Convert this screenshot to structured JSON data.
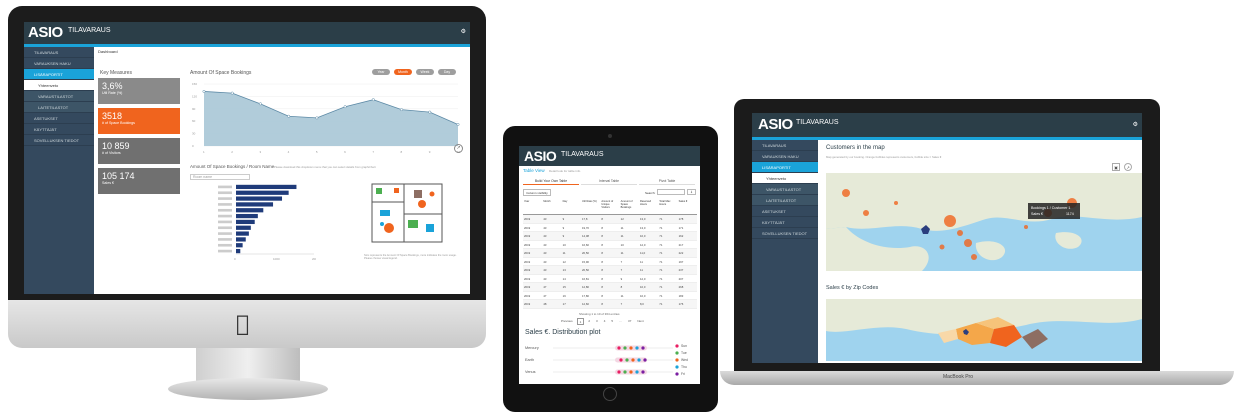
{
  "brand": {
    "name": "ASIO",
    "product": "TILAVARAUS"
  },
  "imac": {
    "breadcrumb": "Dashboard",
    "sidebar": [
      "TILAVARAUS",
      "VARAUKSEN HAKU",
      "LISÄRAPORTIT",
      "Yhteenveto",
      "VARAUSTILASTOT",
      "LAITETILASTOT",
      "ASETUKSET",
      "KÄYTTÄJÄT",
      "SOVELLUKSEN TIEDOT"
    ],
    "key_measures_title": "Key Measures",
    "kpis": [
      {
        "value": "3,6%",
        "label": "Util Rate (%)"
      },
      {
        "value": "3518",
        "label": "# of Space Bookings"
      },
      {
        "value": "10 859",
        "label": "# of Visitors"
      },
      {
        "value": "105 174",
        "label": "Sales €"
      }
    ],
    "line_chart_title": "Amount Of Space Bookings",
    "range_pills": [
      "Year",
      "Month",
      "Week",
      "Day"
    ],
    "bar_chart_title": "Amount Of Space Bookings / Room Name",
    "bar_chart_note": "Please download this dropdown menu that you can select details from graph/chart",
    "filter_placeholder": "Room name",
    "floorplan_note": "Size represents the Amount Of Space Bookings, more indicates the room usage. Please choose visual legend."
  },
  "ipad": {
    "tab_title": "Table View",
    "tab_subtitle": "Detail look for table info",
    "subtabs": [
      "Build Your Own Table",
      "Interval Table",
      "Pivot Table"
    ],
    "column_button": "Column visibility",
    "search_label": "Search:",
    "columns": [
      "Year",
      "Month",
      "Day",
      "Util Rate (%)",
      "Amount of Unique Visitors",
      "Amount of Space Bookings",
      "Reserved Hours",
      "Total Max Hours",
      "Sales €"
    ],
    "rows": [
      [
        "2019",
        "43",
        "9",
        "17,8",
        "8",
        "12",
        "13,0",
        "71",
        "178"
      ],
      [
        "2019",
        "43",
        "9",
        "19,70",
        "8",
        "11",
        "13,0",
        "71",
        "171"
      ],
      [
        "2019",
        "43",
        "9",
        "14,08",
        "8",
        "11",
        "10,0",
        "71",
        "162"
      ],
      [
        "2019",
        "43",
        "10",
        "16,60",
        "8",
        "10",
        "12,0",
        "71",
        "217"
      ],
      [
        "2019",
        "43",
        "11",
        "20,50",
        "8",
        "11",
        "11,0",
        "71",
        "222"
      ],
      [
        "2019",
        "43",
        "12",
        "15,90",
        "8",
        "7",
        "11",
        "71",
        "197"
      ],
      [
        "2019",
        "43",
        "13",
        "20,50",
        "8",
        "7",
        "11",
        "71",
        "237"
      ],
      [
        "2019",
        "43",
        "14",
        "16,81",
        "8",
        "9",
        "12,0",
        "71",
        "207"
      ],
      [
        "2019",
        "47",
        "15",
        "12,80",
        "8",
        "8",
        "10,0",
        "71",
        "268"
      ],
      [
        "2019",
        "47",
        "16",
        "17,80",
        "8",
        "11",
        "10,0",
        "71",
        "183"
      ],
      [
        "2019",
        "48",
        "17",
        "12,60",
        "8",
        "7",
        "8,0",
        "71",
        "176"
      ]
    ],
    "pagination_info": "Showing 1 to 10 of 364 entries",
    "pagination": [
      "Previous",
      "1",
      "2",
      "3",
      "4",
      "5",
      "…",
      "37",
      "Next"
    ],
    "distribution_title": "Sales €. Distribution plot",
    "distribution_rows": [
      "Mercury",
      "Earth",
      "Venus"
    ],
    "legend": [
      "Sun",
      "Tue",
      "Wed",
      "Thu",
      "Fri"
    ]
  },
  "macbook": {
    "sidebar": [
      "TILAVARAUS",
      "VARAUKSEN HAKU",
      "LISÄRAPORTIT",
      "Yhteenveto",
      "VARAUSTILASTOT",
      "LAITETILASTOT",
      "ASETUKSET",
      "KÄYTTÄJÄT",
      "SOVELLUKSEN TIEDOT"
    ],
    "map_title": "Customers in the map",
    "map_subtitle": "Map generated by our booking. Orange bubbles represents customers, bubble size = Sales €",
    "tooltip_line1": "Bookings 1 / Customer 1",
    "tooltip_line2": "Sales €",
    "tooltip_value": "1174",
    "zip_title": "Sales € by Zip Codes",
    "device_label": "MacBook Pro"
  },
  "colors": {
    "navy": "#2b3e48",
    "accent": "#1aa3d9",
    "orange": "#f0641e",
    "sidebar": "#34495e"
  },
  "chart_data": [
    {
      "type": "area",
      "title": "Amount Of Space Bookings",
      "categories": [
        "1",
        "2",
        "3",
        "4",
        "5",
        "6",
        "7",
        "8",
        "9",
        "10"
      ],
      "values": [
        132,
        128,
        102,
        72,
        68,
        95,
        112,
        88,
        82,
        52
      ],
      "ylim": [
        0,
        150
      ]
    },
    {
      "type": "bar",
      "title": "Amount Of Space Bookings / Room Name",
      "values": [
        1550,
        1350,
        1180,
        950,
        700,
        560,
        480,
        380,
        330,
        250,
        170,
        110
      ],
      "xlim": [
        0,
        2000
      ]
    }
  ]
}
